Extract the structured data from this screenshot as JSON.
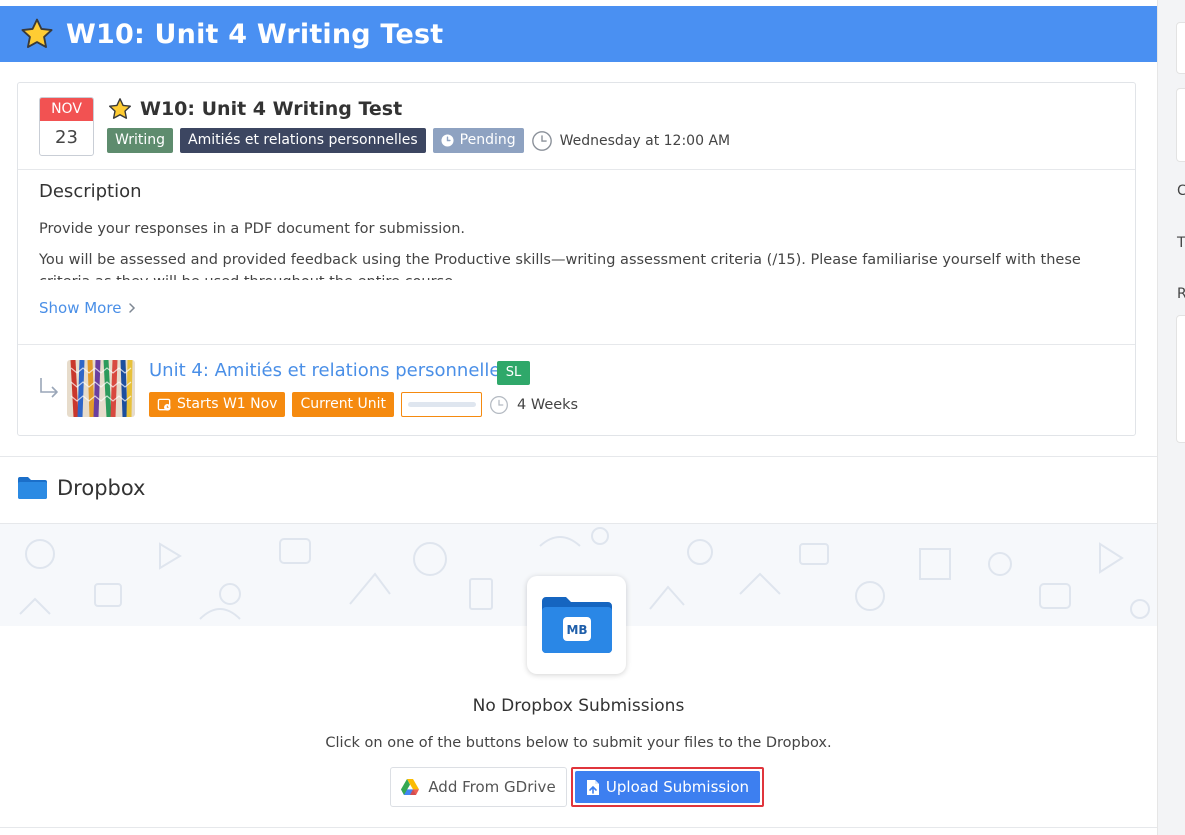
{
  "header": {
    "title": "W10: Unit 4 Writing Test"
  },
  "event": {
    "month": "NOV",
    "day": "23",
    "title": "W10: Unit 4 Writing Test",
    "badges": {
      "type": "Writing",
      "unit": "Amitiés et relations personnelles",
      "status": "Pending"
    },
    "due": "Wednesday at 12:00 AM"
  },
  "description": {
    "heading": "Description",
    "paragraphs": [
      "Provide your responses in a PDF document for submission.",
      "You will be assessed and provided feedback using the Productive skills—writing assessment criteria (/15). Please familiarise yourself with these criteria as they will be used throughout the entire course."
    ],
    "show_more": "Show More"
  },
  "unit": {
    "title": "Unit 4: Amitiés et relations personnelles",
    "level": "SL",
    "starts": "Starts W1 Nov",
    "current": "Current Unit",
    "progress": 0,
    "duration": "4 Weeks"
  },
  "dropbox": {
    "heading": "Dropbox",
    "empty_title": "No Dropbox Submissions",
    "empty_sub": "Click on one of the buttons below to submit your files to the Dropbox.",
    "gdrive_button": "Add From GDrive",
    "upload_button": "Upload Submission"
  },
  "colors": {
    "header": "#4a90f2",
    "link": "#4a8fe7",
    "upload": "#3d7ff0",
    "highlight": "#e0353c",
    "orange": "#f58a0f"
  },
  "icons": [
    "star-icon",
    "clock-icon",
    "chevron-right-icon",
    "arrow-return-icon",
    "folder-icon",
    "gdrive-icon",
    "file-upload-icon"
  ],
  "right_rail": {
    "letters": [
      "C",
      "T",
      "R"
    ]
  }
}
